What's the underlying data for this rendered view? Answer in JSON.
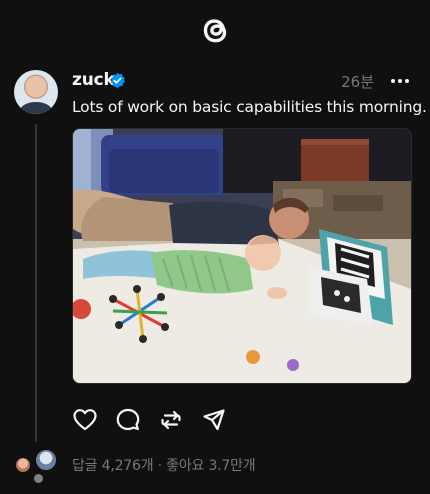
{
  "app": {
    "logo_icon": "threads-logo-icon",
    "background": "#101010",
    "accent": "#0095f6"
  },
  "post": {
    "author": "zuck",
    "verified": true,
    "time": "26분",
    "text": "Lots of work on basic capabilities this morning.",
    "image_description": "Photo of a man lying on the floor next to a baby doing tummy time on a play mat"
  },
  "actions": [
    "heart-icon",
    "comment-icon",
    "repost-icon",
    "share-icon"
  ],
  "stats": {
    "replies_label": "답글 4,276개",
    "separator": "·",
    "likes_label": "좋아요 3.7만개"
  }
}
